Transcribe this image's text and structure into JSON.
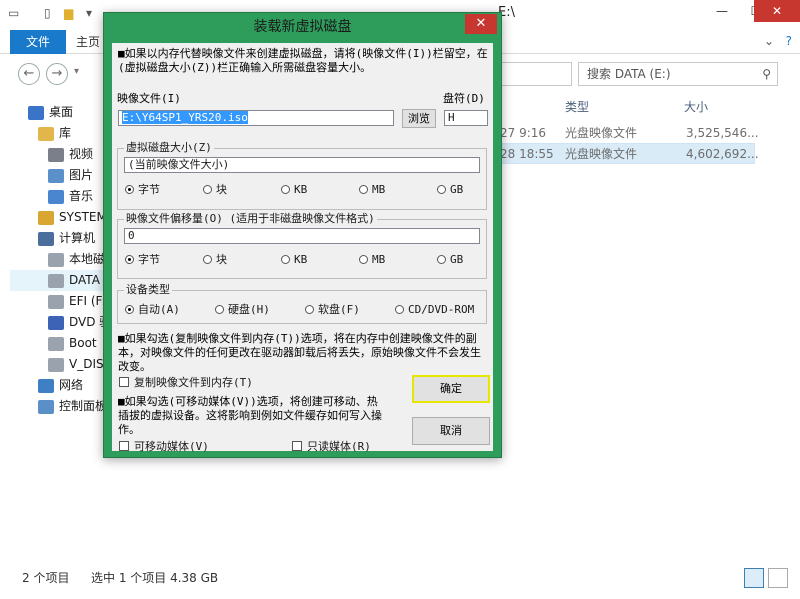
{
  "explorer": {
    "title_fragment": "E:\\",
    "title_behind": "装载新虚拟磁盘",
    "tabs": {
      "file": "文件",
      "home": "主页"
    },
    "search_placeholder": "搜索 DATA (E:)",
    "nav": [
      {
        "label": "桌面",
        "icon": "desktop-icon"
      },
      {
        "label": "库",
        "icon": "library-icon"
      },
      {
        "label": "视频",
        "icon": "video-icon"
      },
      {
        "label": "图片",
        "icon": "picture-icon"
      },
      {
        "label": "音乐",
        "icon": "music-icon"
      },
      {
        "label": "SYSTEM",
        "icon": "drive-icon"
      },
      {
        "label": "计算机",
        "icon": "computer-icon"
      },
      {
        "label": "本地磁",
        "icon": "drive-icon"
      },
      {
        "label": "DATA",
        "icon": "drive-icon"
      },
      {
        "label": "EFI (F:",
        "icon": "drive-icon"
      },
      {
        "label": "DVD 驱",
        "icon": "dvd-icon"
      },
      {
        "label": "Boot",
        "icon": "drive-icon"
      },
      {
        "label": "V_DIS",
        "icon": "drive-icon"
      },
      {
        "label": "网络",
        "icon": "network-icon"
      },
      {
        "label": "控制面板",
        "icon": "control-panel-icon"
      }
    ],
    "columns": {
      "type": "类型",
      "size": "大小"
    },
    "files": [
      {
        "date": "27 9:16",
        "type": "光盘映像文件",
        "size": "3,525,546..."
      },
      {
        "date": "28 18:55",
        "type": "光盘映像文件",
        "size": "4,602,692..."
      }
    ],
    "status": {
      "count": "2 个项目",
      "selected": "选中 1 个项目  4.38 GB"
    }
  },
  "dialog": {
    "title": "装载新虚拟磁盘",
    "close": "✕",
    "note_top": "■如果以内存代替映像文件来创建虚拟磁盘，请将(映像文件(I))栏留空，在(虚拟磁盘大小(Z))栏正确输入所需磁盘容量大小。",
    "image_file_label": "映像文件(I)",
    "drive_letter_label": "盘符(D)",
    "image_file_value": "E:\\Y64SP1_YRS20.iso",
    "browse_button": "浏览",
    "drive_letter_value": "H",
    "disk_size": {
      "label": "虚拟磁盘大小(Z)",
      "value": "(当前映像文件大小)",
      "units": [
        "字节",
        "块",
        "KB",
        "MB",
        "GB"
      ],
      "selected_index": 0
    },
    "offset": {
      "label": "映像文件偏移量(O) (适用于非磁盘映像文件格式)",
      "value": "0",
      "units": [
        "字节",
        "块",
        "KB",
        "MB",
        "GB"
      ],
      "selected_index": 0
    },
    "device_type": {
      "label": "设备类型",
      "options": [
        "自动(A)",
        "硬盘(H)",
        "软盘(F)",
        "CD/DVD-ROM"
      ],
      "selected_index": 0
    },
    "note_copy": "■如果勾选(复制映像文件到内存(T))选项，将在内存中创建映像文件的副本，对映像文件的任何更改在驱动器卸载后将丢失，原始映像文件不会发生改变。",
    "copy_to_memory": "复制映像文件到内存(T)",
    "note_removable": "■如果勾选(可移动媒体(V))选项，将创建可移动、热插拔的虚拟设备。这将影响到例如文件缓存如何写入操作。",
    "removable": "可移动媒体(V)",
    "readonly": "只读媒体(R)",
    "ok_button": "确定",
    "cancel_button": "取消"
  }
}
